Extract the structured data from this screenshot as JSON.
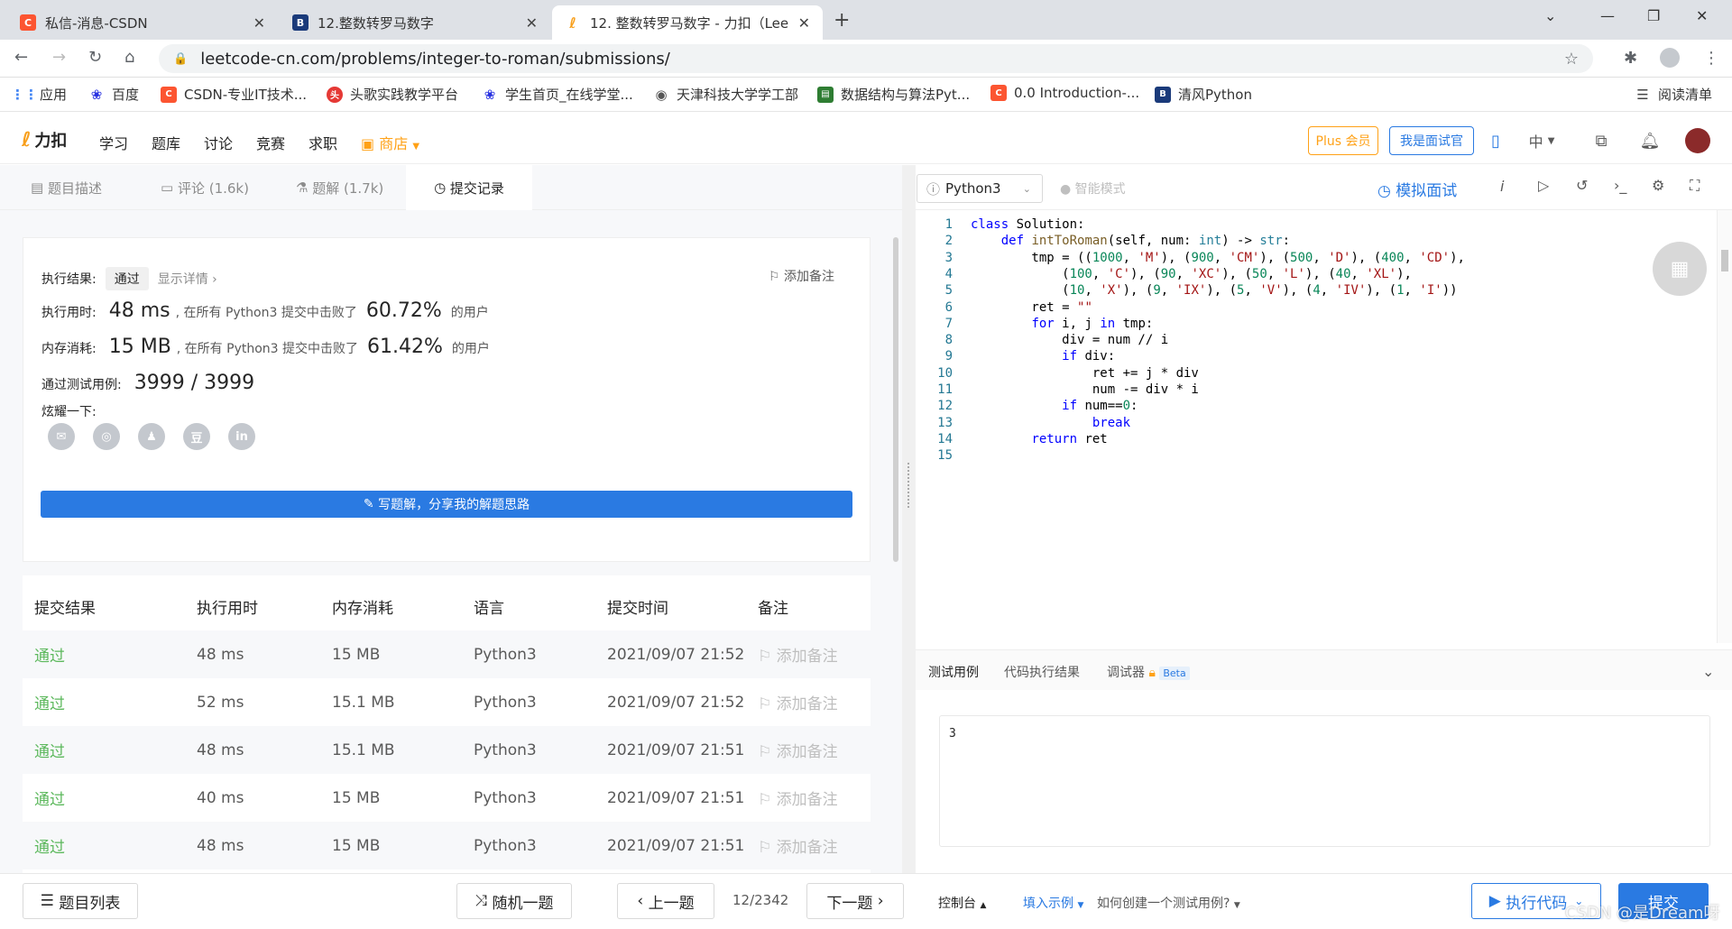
{
  "browser": {
    "tabs": [
      {
        "title": "私信-消息-CSDN",
        "icon_color": "#fc5531",
        "icon": "C"
      },
      {
        "title": "12.整数转罗马数字",
        "icon_color": "#1a3a7a",
        "icon": "B"
      },
      {
        "title": "12. 整数转罗马数字 - 力扣（Lee",
        "icon_color": "#ffffff",
        "icon": "leetcode-icon"
      }
    ],
    "url": "leetcode-cn.com/problems/integer-to-roman/submissions/",
    "bookmarks": [
      {
        "label": "应用",
        "icon_color": "#4285f4"
      },
      {
        "label": "百度",
        "icon_color": "#2932e1"
      },
      {
        "label": "CSDN-专业IT技术...",
        "icon_color": "#fc5531"
      },
      {
        "label": "头歌实践教学平台",
        "icon_color": "#e53935"
      },
      {
        "label": "学生首页_在线学堂...",
        "icon_color": "#2932e1"
      },
      {
        "label": "天津科技大学学工部",
        "icon_color": "#555555"
      },
      {
        "label": "数据结构与算法Pyt...",
        "icon_color": "#2e7d32"
      },
      {
        "label": "0.0 Introduction-...",
        "icon_color": "#fc5531"
      },
      {
        "label": "清风Python",
        "icon_color": "#1a3a7a"
      }
    ],
    "reading_list": "阅读清单"
  },
  "site": {
    "logo": "力扣",
    "nav": [
      "学习",
      "题库",
      "讨论",
      "竞赛",
      "求职"
    ],
    "store": "商店",
    "plus": "Plus 会员",
    "interviewer": "我是面试官",
    "lang": "中"
  },
  "left_tabs": [
    {
      "label": "题目描述"
    },
    {
      "label": "评论 (1.6k)"
    },
    {
      "label": "题解 (1.7k)"
    },
    {
      "label": "提交记录"
    }
  ],
  "result": {
    "status_label": "执行结果:",
    "status": "通过",
    "details": "显示详情 ›",
    "add_note": "添加备注",
    "time_label": "执行用时:",
    "time_value": "48 ms",
    "time_text": ", 在所有 Python3 提交中击败了",
    "time_pct": "60.72%",
    "users": "的用户",
    "mem_label": "内存消耗:",
    "mem_value": "15 MB",
    "mem_text": ", 在所有 Python3 提交中击败了",
    "mem_pct": "61.42%",
    "tests_label": "通过测试用例:",
    "tests_value": "3999 / 3999",
    "share_label": "炫耀一下:",
    "share_icons": [
      "wechat-icon",
      "weibo-icon",
      "qq-icon",
      "douban-icon",
      "linkedin-icon"
    ],
    "share_glyphs": [
      "✉",
      "◎",
      "♟",
      "豆",
      "in"
    ],
    "write_btn": "写题解，分享我的解题思路"
  },
  "submissions": {
    "headers": [
      "提交结果",
      "执行用时",
      "内存消耗",
      "语言",
      "提交时间",
      "备注"
    ],
    "rows": [
      {
        "result": "通过",
        "time": "48 ms",
        "mem": "15 MB",
        "lang": "Python3",
        "date": "2021/09/07 21:52",
        "note": "添加备注"
      },
      {
        "result": "通过",
        "time": "52 ms",
        "mem": "15.1 MB",
        "lang": "Python3",
        "date": "2021/09/07 21:52",
        "note": "添加备注"
      },
      {
        "result": "通过",
        "time": "48 ms",
        "mem": "15.1 MB",
        "lang": "Python3",
        "date": "2021/09/07 21:51",
        "note": "添加备注"
      },
      {
        "result": "通过",
        "time": "40 ms",
        "mem": "15 MB",
        "lang": "Python3",
        "date": "2021/09/07 21:51",
        "note": "添加备注"
      },
      {
        "result": "通过",
        "time": "48 ms",
        "mem": "15 MB",
        "lang": "Python3",
        "date": "2021/09/07 21:51",
        "note": "添加备注"
      }
    ]
  },
  "editor": {
    "language": "Python3",
    "smart_mode": "智能模式",
    "mock_interview": "模拟面试",
    "code_lines": [
      "class Solution:",
      "    def intToRoman(self, num: int) -> str:",
      "        tmp = ((1000, 'M'), (900, 'CM'), (500, 'D'), (400, 'CD'),",
      "            (100, 'C'), (90, 'XC'), (50, 'L'), (40, 'XL'),",
      "            (10, 'X'), (9, 'IX'), (5, 'V'), (4, 'IV'), (1, 'I'))",
      "        ret = \"\"",
      "        for i, j in tmp:",
      "            div = num // i",
      "            if div:",
      "                ret += j * div",
      "                num -= div * i",
      "            if num==0:",
      "                break",
      "        return ret",
      ""
    ]
  },
  "console": {
    "tabs": [
      "测试用例",
      "代码执行结果",
      "调试器"
    ],
    "beta": "Beta",
    "test_input": "3"
  },
  "bottom": {
    "problem_list": "题目列表",
    "random": "随机一题",
    "prev": "上一题",
    "page": "12/2342",
    "next": "下一题",
    "console": "控制台",
    "fill_example": "填入示例",
    "how_create": "如何创建一个测试用例?",
    "run": "执行代码",
    "submit": "提交"
  },
  "watermark": "CSDN @是Dream呀"
}
